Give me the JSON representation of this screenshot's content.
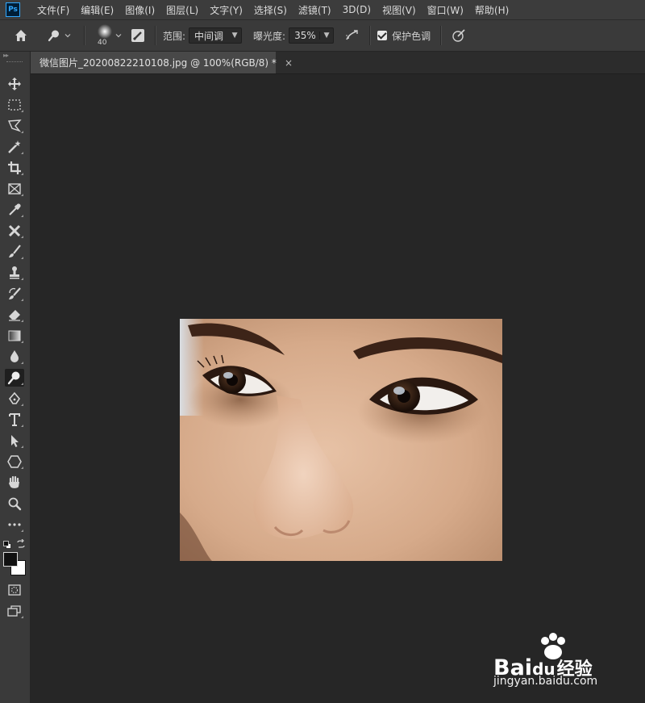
{
  "app": {
    "logo": "Ps"
  },
  "menu": [
    "文件(F)",
    "编辑(E)",
    "图像(I)",
    "图层(L)",
    "文字(Y)",
    "选择(S)",
    "滤镜(T)",
    "3D(D)",
    "视图(V)",
    "窗口(W)",
    "帮助(H)"
  ],
  "options": {
    "brush_size": "40",
    "range_label": "范围:",
    "range_value": "中间调",
    "exposure_label": "曝光度:",
    "exposure_value": "35%",
    "protect_tones_label": "保护色调",
    "protect_tones_checked": true
  },
  "document": {
    "tab_title": "微信图片_20200822210108.jpg @ 100%(RGB/8) *",
    "close_glyph": "×",
    "zoom": "100%"
  },
  "tools": [
    {
      "name": "move-tool",
      "icon": "move-icon"
    },
    {
      "name": "marquee-tool",
      "icon": "marquee-icon"
    },
    {
      "name": "lasso-tool",
      "icon": "lasso-icon"
    },
    {
      "name": "magic-wand-tool",
      "icon": "magic-wand-icon"
    },
    {
      "name": "crop-tool",
      "icon": "crop-icon"
    },
    {
      "name": "frame-tool",
      "icon": "frame-icon"
    },
    {
      "name": "eyedropper-tool",
      "icon": "eyedropper-icon"
    },
    {
      "name": "healing-tool",
      "icon": "healing-icon"
    },
    {
      "name": "brush-tool",
      "icon": "brush-icon"
    },
    {
      "name": "stamp-tool",
      "icon": "stamp-icon"
    },
    {
      "name": "history-brush-tool",
      "icon": "history-brush-icon"
    },
    {
      "name": "eraser-tool",
      "icon": "eraser-icon"
    },
    {
      "name": "gradient-tool",
      "icon": "gradient-icon"
    },
    {
      "name": "blur-tool",
      "icon": "blur-icon"
    },
    {
      "name": "dodge-tool",
      "icon": "dodge-icon",
      "active": true
    },
    {
      "name": "pen-tool",
      "icon": "pen-icon"
    },
    {
      "name": "type-tool",
      "icon": "type-icon"
    },
    {
      "name": "path-select-tool",
      "icon": "path-select-icon"
    },
    {
      "name": "shape-tool",
      "icon": "shape-icon"
    },
    {
      "name": "hand-tool",
      "icon": "hand-icon"
    },
    {
      "name": "zoom-tool",
      "icon": "zoom-icon"
    },
    {
      "name": "more-tools",
      "icon": "more-icon"
    }
  ],
  "colors": {
    "foreground": "#1a1a1a",
    "background": "#ffffff",
    "ui_dark": "#262626",
    "ui_panel": "#3a3a3a"
  },
  "watermark": {
    "brand": "Bai",
    "brand2": "du",
    "suffix": "经验",
    "url": "jingyan.baidu.com"
  }
}
